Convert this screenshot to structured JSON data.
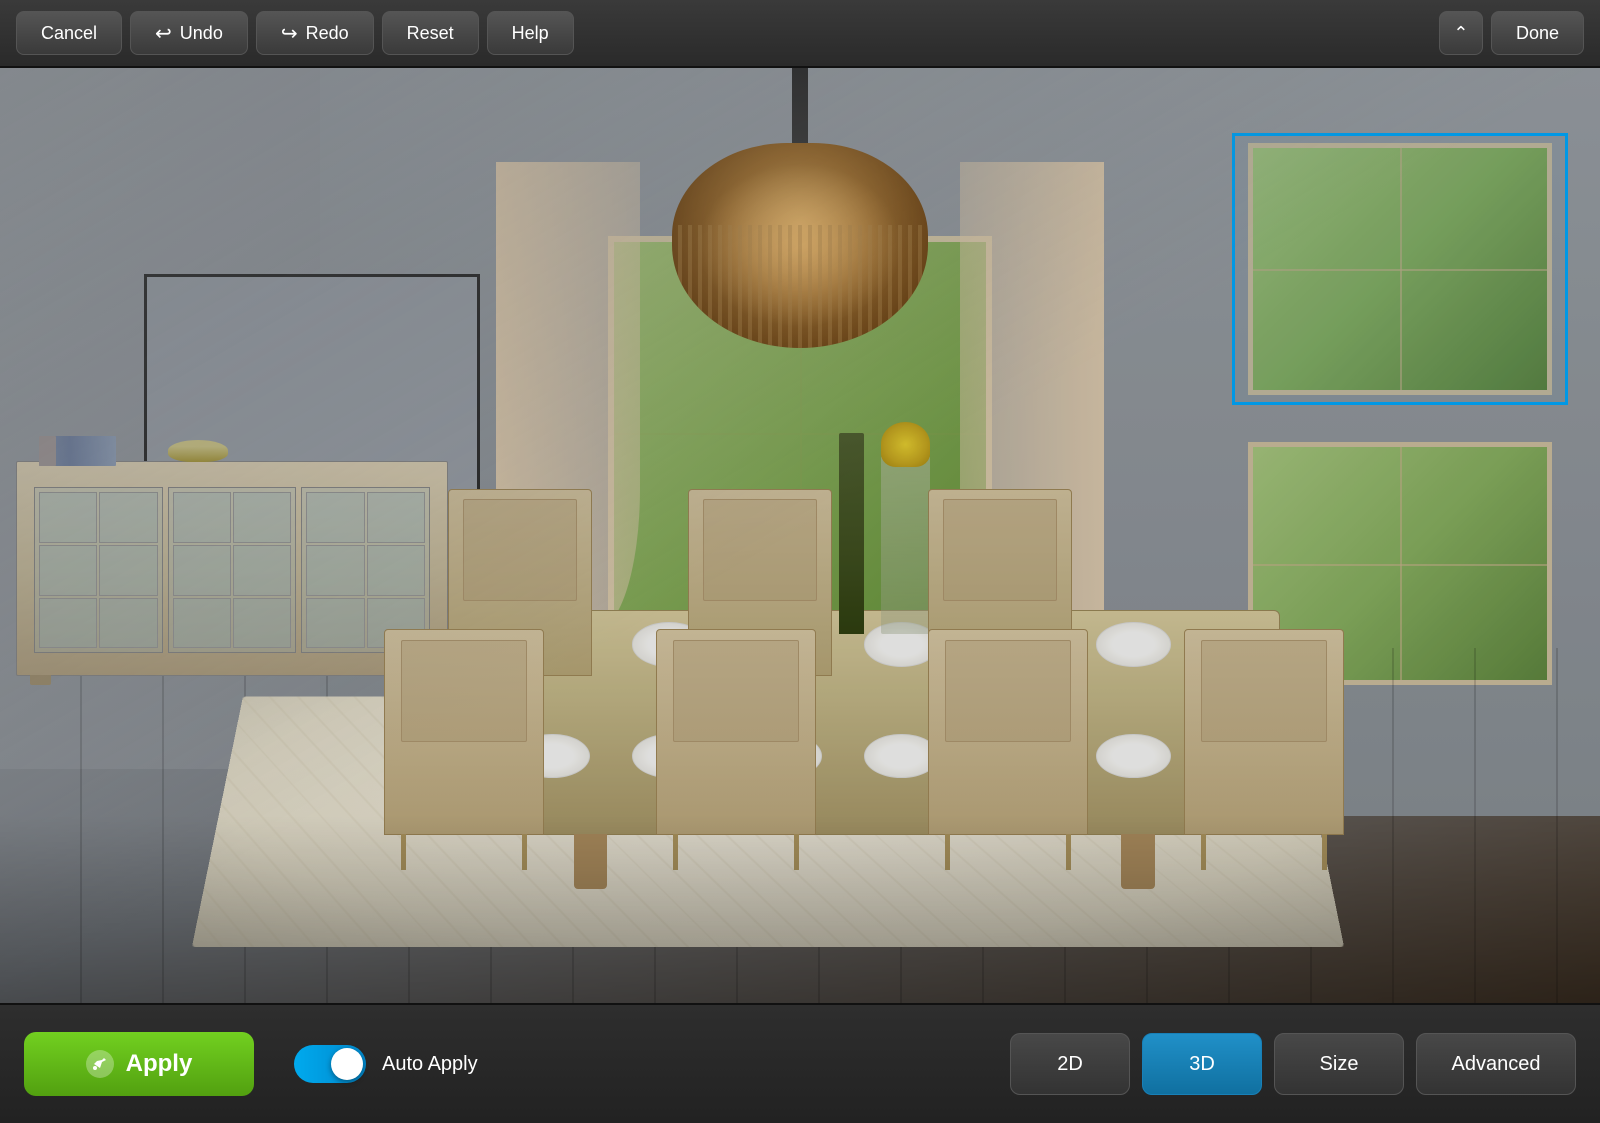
{
  "toolbar": {
    "cancel_label": "Cancel",
    "undo_label": "Undo",
    "redo_label": "Redo",
    "reset_label": "Reset",
    "help_label": "Help",
    "done_label": "Done",
    "chevron_icon": "chevron-up"
  },
  "bottom_bar": {
    "apply_label": "Apply",
    "auto_apply_label": "Auto Apply",
    "toggle_state": "on",
    "btn_2d_label": "2D",
    "btn_3d_label": "3D",
    "size_label": "Size",
    "advanced_label": "Advanced",
    "active_view": "3D"
  },
  "scene": {
    "description": "Dining room interior with table, chairs, chandelier, and sideboard"
  }
}
